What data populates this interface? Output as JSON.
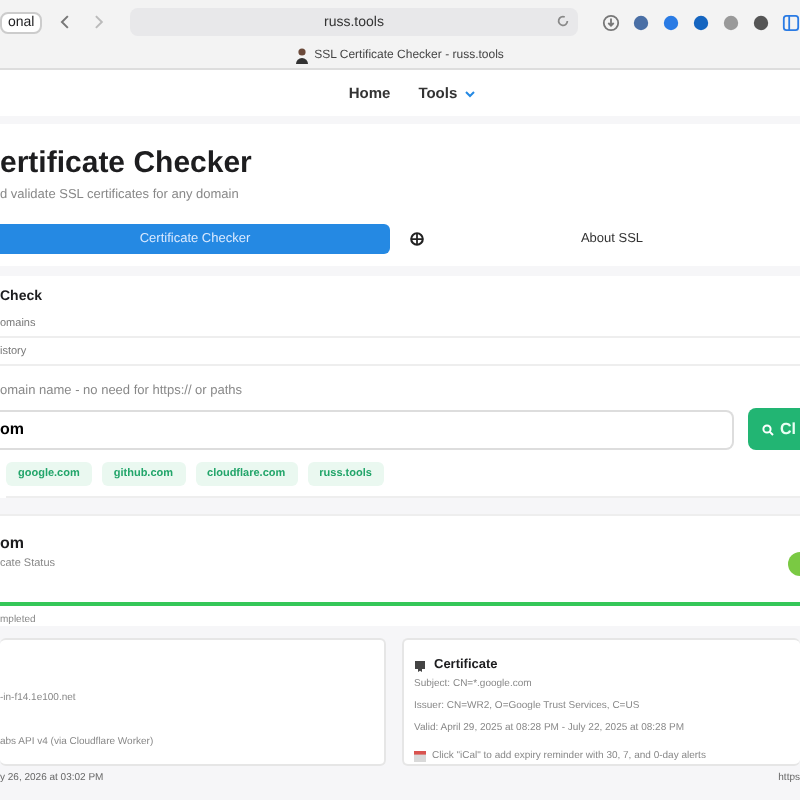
{
  "browser": {
    "profile": "onal",
    "url": "russ.tools",
    "tab_title": "SSL Certificate Checker - russ.tools"
  },
  "nav": [
    {
      "label": "Home",
      "kind": "link"
    },
    {
      "label": "Tools",
      "kind": "menu"
    }
  ],
  "header": {
    "title": "ertificate Checker",
    "subtitle": "d validate SSL certificates for any domain"
  },
  "tabs": [
    {
      "label": "Certificate Checker",
      "selected": true
    },
    {
      "label": "About SSL",
      "selected": false
    }
  ],
  "check": {
    "title": "Check",
    "options": [
      "omains",
      "istory"
    ],
    "hint": "omain name - no need for https:// or paths",
    "value": "om",
    "button": "Cl",
    "quick": [
      "google.com",
      "github.com",
      "cloudflare.com",
      "russ.tools"
    ]
  },
  "result": {
    "domain": "om",
    "subtitle": "cate Status",
    "level": 1,
    "status": "mpleted"
  },
  "server_card": {
    "lines": [
      "-in-f14.1e100.net",
      "abs API v4 (via Cloudflare Worker)"
    ]
  },
  "cert_card": {
    "title": "Certificate",
    "lines": [
      "Subject: CN=*.google.com",
      "Issuer: CN=WR2, O=Google Trust Services, C=US",
      "Valid: April 29, 2025 at 08:28 PM - July 22, 2025 at 08:28 PM"
    ],
    "reminder": "Click \"iCal\" to add expiry reminder with 30, 7, and 0-day alerts"
  },
  "footer": {
    "timestamp": "y 26, 2026 at 03:02 PM",
    "link": "https"
  }
}
